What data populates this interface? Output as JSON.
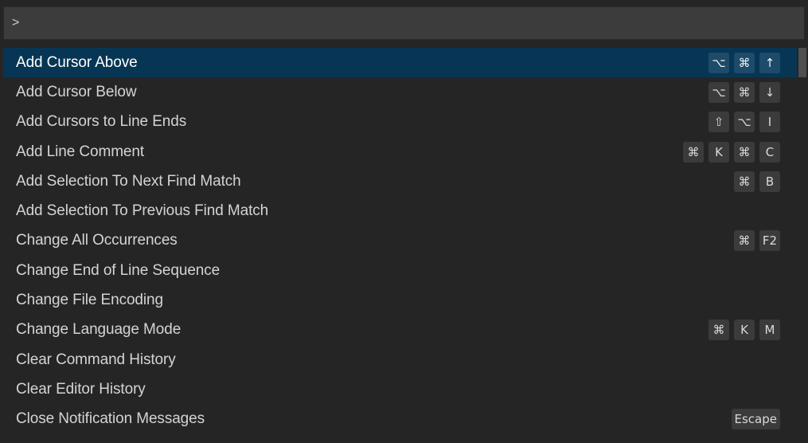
{
  "search": {
    "value": ">"
  },
  "commands": [
    {
      "label": "Add Cursor Above",
      "keys": [
        "⌥",
        "⌘",
        "↑"
      ],
      "selected": true
    },
    {
      "label": "Add Cursor Below",
      "keys": [
        "⌥",
        "⌘",
        "↓"
      ]
    },
    {
      "label": "Add Cursors to Line Ends",
      "keys": [
        "⇧",
        "⌥",
        "I"
      ]
    },
    {
      "label": "Add Line Comment",
      "keys": [
        "⌘",
        "K",
        "⌘",
        "C"
      ]
    },
    {
      "label": "Add Selection To Next Find Match",
      "keys": [
        "⌘",
        "B"
      ]
    },
    {
      "label": "Add Selection To Previous Find Match",
      "keys": []
    },
    {
      "label": "Change All Occurrences",
      "keys": [
        "⌘",
        "F2"
      ]
    },
    {
      "label": "Change End of Line Sequence",
      "keys": []
    },
    {
      "label": "Change File Encoding",
      "keys": []
    },
    {
      "label": "Change Language Mode",
      "keys": [
        "⌘",
        "K",
        "M"
      ]
    },
    {
      "label": "Clear Command History",
      "keys": []
    },
    {
      "label": "Clear Editor History",
      "keys": []
    },
    {
      "label": "Close Notification Messages",
      "keys": [
        "Escape"
      ]
    }
  ],
  "colors": {
    "background": "#252526",
    "input_background": "#3c3c3c",
    "selection_background": "#073655",
    "key_background": "#3b3b3c",
    "text": "#d4d4d4"
  }
}
